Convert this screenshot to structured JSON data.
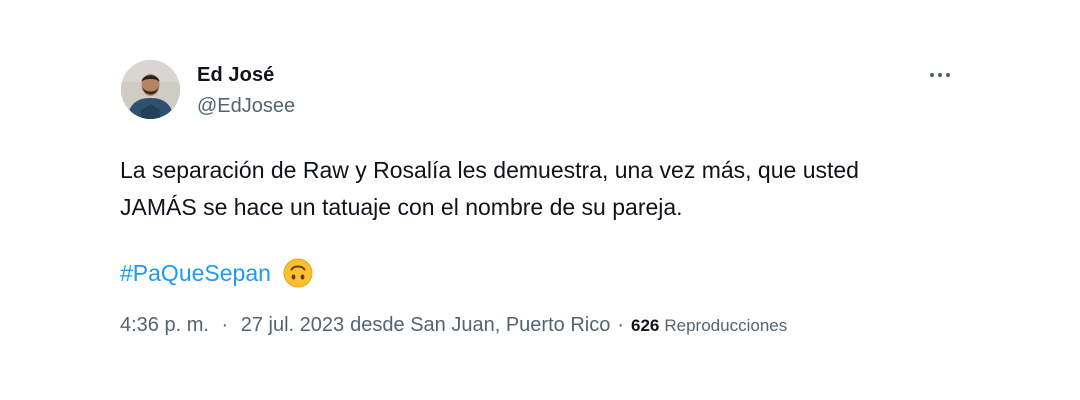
{
  "author": {
    "display_name": "Ed José",
    "handle": "@EdJosee"
  },
  "tweet": {
    "text_lines": [
      "La separación de Raw y Rosalía les demuestra, una vez más, que usted",
      "JAMÁS se hace un tatuaje con el nombre de su pareja."
    ],
    "hashtag": "#PaQueSepan",
    "emoji": "upside-down-face-emoji"
  },
  "meta": {
    "time": "4:36 p. m.",
    "separator": "·",
    "date": "27 jul. 2023",
    "location": "desde San Juan, Puerto Rico",
    "views_count": "626",
    "views_label": "Reproducciones"
  },
  "colors": {
    "text": "#0f1419",
    "secondary": "#536471",
    "link": "#1d9bf0",
    "background": "#ffffff"
  },
  "icons": {
    "more": "more-dots-icon",
    "avatar": "avatar"
  }
}
